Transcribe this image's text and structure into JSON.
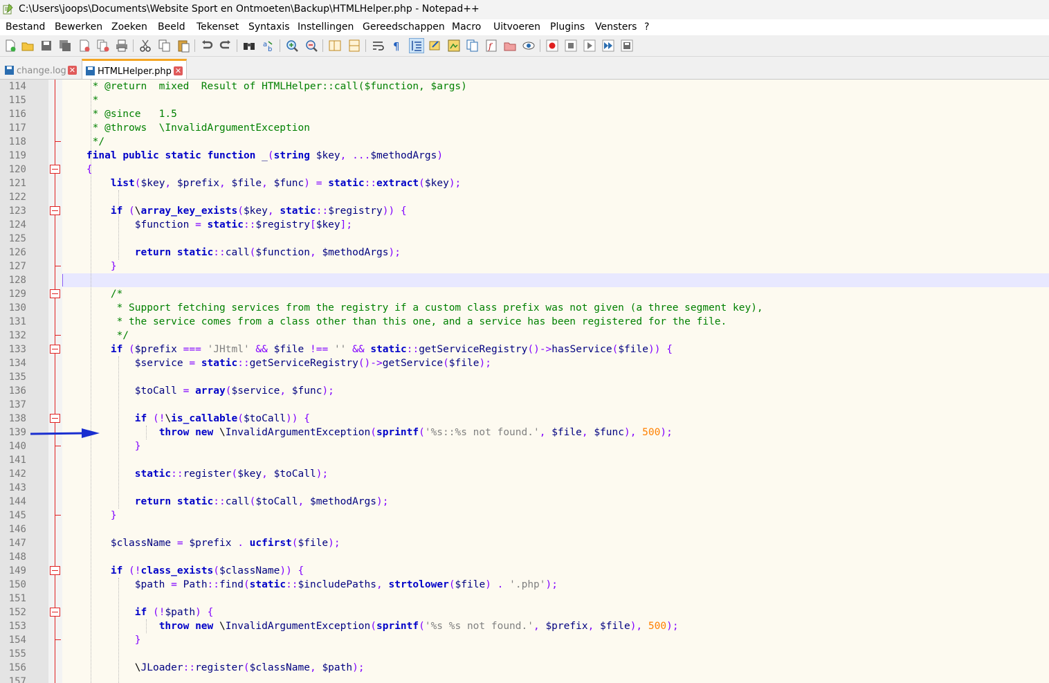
{
  "window": {
    "title": "C:\\Users\\joops\\Documents\\Website Sport en Ontmoeten\\Backup\\HTMLHelper.php - Notepad++"
  },
  "menu": [
    "Bestand",
    "Bewerken",
    "Zoeken",
    "Beeld",
    "Tekenset",
    "Syntaxis",
    "Instellingen",
    "Gereedschappen",
    "Macro",
    "Uitvoeren",
    "Plugins",
    "Vensters",
    "?"
  ],
  "tabs": [
    {
      "label": "change.log",
      "active": false
    },
    {
      "label": "HTMLHelper.php",
      "active": true
    }
  ],
  "colors": {
    "comment": "#008000",
    "keyword": "#0000c8",
    "string": "#808080",
    "number": "#ff8000",
    "operator": "#8000ff",
    "fold_marker": "#e02020",
    "active_tab_accent": "#f5a623",
    "annotation_arrow": "#1a2fd0"
  },
  "editor": {
    "current_line": 128,
    "lines": [
      {
        "n": "114",
        "text": "     * @return  mixed  Result of HTMLHelper::call($function, $args)"
      },
      {
        "n": "115",
        "text": "     *"
      },
      {
        "n": "116",
        "text": "     * @since   1.5"
      },
      {
        "n": "117",
        "text": "     * @throws  \\InvalidArgumentException"
      },
      {
        "n": "118",
        "text": "     */"
      },
      {
        "n": "119",
        "text": "    final public static function _(string $key, ...$methodArgs)"
      },
      {
        "n": "120",
        "text": "    {"
      },
      {
        "n": "121",
        "text": "        list($key, $prefix, $file, $func) = static::extract($key);"
      },
      {
        "n": "122",
        "text": ""
      },
      {
        "n": "123",
        "text": "        if (\\array_key_exists($key, static::$registry)) {"
      },
      {
        "n": "124",
        "text": "            $function = static::$registry[$key];"
      },
      {
        "n": "125",
        "text": ""
      },
      {
        "n": "126",
        "text": "            return static::call($function, $methodArgs);"
      },
      {
        "n": "127",
        "text": "        }"
      },
      {
        "n": "128",
        "text": ""
      },
      {
        "n": "129",
        "text": "        /*"
      },
      {
        "n": "130",
        "text": "         * Support fetching services from the registry if a custom class prefix was not given (a three segment key),"
      },
      {
        "n": "131",
        "text": "         * the service comes from a class other than this one, and a service has been registered for the file."
      },
      {
        "n": "132",
        "text": "         */"
      },
      {
        "n": "133",
        "text": "        if ($prefix === 'JHtml' && $file !== '' && static::getServiceRegistry()->hasService($file)) {"
      },
      {
        "n": "134",
        "text": "            $service = static::getServiceRegistry()->getService($file);"
      },
      {
        "n": "135",
        "text": ""
      },
      {
        "n": "136",
        "text": "            $toCall = array($service, $func);"
      },
      {
        "n": "137",
        "text": ""
      },
      {
        "n": "138",
        "text": "            if (!\\is_callable($toCall)) {"
      },
      {
        "n": "139",
        "text": "                throw new \\InvalidArgumentException(sprintf('%s::%s not found.', $file, $func), 500);"
      },
      {
        "n": "140",
        "text": "            }"
      },
      {
        "n": "141",
        "text": ""
      },
      {
        "n": "142",
        "text": "            static::register($key, $toCall);"
      },
      {
        "n": "143",
        "text": ""
      },
      {
        "n": "144",
        "text": "            return static::call($toCall, $methodArgs);"
      },
      {
        "n": "145",
        "text": "        }"
      },
      {
        "n": "146",
        "text": ""
      },
      {
        "n": "147",
        "text": "        $className = $prefix . ucfirst($file);"
      },
      {
        "n": "148",
        "text": ""
      },
      {
        "n": "149",
        "text": "        if (!class_exists($className)) {"
      },
      {
        "n": "150",
        "text": "            $path = Path::find(static::$includePaths, strtolower($file) . '.php');"
      },
      {
        "n": "151",
        "text": ""
      },
      {
        "n": "152",
        "text": "            if (!$path) {"
      },
      {
        "n": "153",
        "text": "                throw new \\InvalidArgumentException(sprintf('%s %s not found.', $prefix, $file), 500);"
      },
      {
        "n": "154",
        "text": "            }"
      },
      {
        "n": "155",
        "text": ""
      },
      {
        "n": "156",
        "text": "            \\JLoader::register($className, $path);"
      },
      {
        "n": "157",
        "text": ""
      }
    ]
  }
}
